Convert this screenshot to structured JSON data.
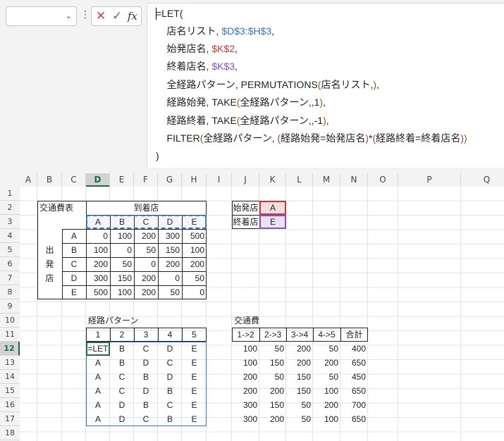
{
  "namebox": {
    "value": "",
    "caret": "⌄"
  },
  "formula_bar": {
    "dots": "⋮",
    "cancel": "✕",
    "enter": "✓",
    "fx": "fx",
    "lines": [
      [
        {
          "t": "=LET(",
          "c": ""
        }
      ],
      [
        {
          "t": "    店名リスト, ",
          "c": ""
        },
        {
          "t": "$D$3:$H$3",
          "c": "c-blue"
        },
        {
          "t": ",",
          "c": ""
        }
      ],
      [
        {
          "t": "    始発店名, ",
          "c": ""
        },
        {
          "t": "$K$2",
          "c": "c-red"
        },
        {
          "t": ",",
          "c": ""
        }
      ],
      [
        {
          "t": "    終着店名, ",
          "c": ""
        },
        {
          "t": "$K$3",
          "c": "c-purple"
        },
        {
          "t": ",",
          "c": ""
        }
      ],
      [
        {
          "t": "    全経路パターン, PERMUTATIONS",
          "c": ""
        },
        {
          "t": "(",
          "c": "c-par1"
        },
        {
          "t": "店名リスト,",
          "c": ""
        },
        {
          "t": ")",
          "c": "c-par1"
        },
        {
          "t": ",",
          "c": ""
        }
      ],
      [
        {
          "t": "    経路始発, TAKE",
          "c": ""
        },
        {
          "t": "(",
          "c": "c-par1"
        },
        {
          "t": "全経路パターン,,1",
          "c": ""
        },
        {
          "t": ")",
          "c": "c-par1"
        },
        {
          "t": ",",
          "c": ""
        }
      ],
      [
        {
          "t": "    経路終着, TAKE",
          "c": ""
        },
        {
          "t": "(",
          "c": "c-par1"
        },
        {
          "t": "全経路パターン,,-1",
          "c": ""
        },
        {
          "t": ")",
          "c": "c-par1"
        },
        {
          "t": ",",
          "c": ""
        }
      ],
      [
        {
          "t": "    FILTER",
          "c": ""
        },
        {
          "t": "(",
          "c": "c-par1"
        },
        {
          "t": "全経路パターン, ",
          "c": ""
        },
        {
          "t": "(",
          "c": "c-par2"
        },
        {
          "t": "経路始発=始発店名",
          "c": ""
        },
        {
          "t": ")",
          "c": "c-par2"
        },
        {
          "t": "*",
          "c": ""
        },
        {
          "t": "(",
          "c": "c-par2"
        },
        {
          "t": "経路終着=終着店名",
          "c": ""
        },
        {
          "t": ")",
          "c": "c-par2"
        },
        {
          "t": ")",
          "c": "c-par1"
        }
      ],
      [
        {
          "t": ")",
          "c": ""
        }
      ]
    ]
  },
  "columns": [
    "A",
    "B",
    "C",
    "D",
    "E",
    "F",
    "G",
    "H",
    "I",
    "J",
    "K",
    "L",
    "M",
    "N",
    "O",
    "P",
    "Q"
  ],
  "selected_column": "D",
  "rows": [
    "1",
    "2",
    "3",
    "4",
    "5",
    "6",
    "7",
    "8",
    "9",
    "10",
    "11",
    "12",
    "13",
    "14",
    "15",
    "16",
    "17",
    "18"
  ],
  "selected_row": "12",
  "cost_table": {
    "title": "交通費表",
    "to_header": "到着店",
    "from_header": [
      "出",
      "発",
      "店"
    ],
    "stores": [
      "A",
      "B",
      "C",
      "D",
      "E"
    ],
    "matrix": [
      [
        "0",
        "100",
        "200",
        "300",
        "500"
      ],
      [
        "100",
        "0",
        "50",
        "150",
        "100"
      ],
      [
        "200",
        "50",
        "0",
        "200",
        "200"
      ],
      [
        "300",
        "150",
        "200",
        "0",
        "50"
      ],
      [
        "500",
        "100",
        "200",
        "50",
        "0"
      ]
    ]
  },
  "params": {
    "start_label": "始発店",
    "start_value": "A",
    "end_label": "終着店",
    "end_value": "E"
  },
  "routes": {
    "title": "経路パターン",
    "headers": [
      "1",
      "2",
      "3",
      "4",
      "5"
    ],
    "rows": [
      [
        "=LET",
        "B",
        "C",
        "D",
        "E"
      ],
      [
        "A",
        "B",
        "D",
        "C",
        "E"
      ],
      [
        "A",
        "C",
        "B",
        "D",
        "E"
      ],
      [
        "A",
        "C",
        "D",
        "B",
        "E"
      ],
      [
        "A",
        "D",
        "B",
        "C",
        "E"
      ],
      [
        "A",
        "D",
        "C",
        "B",
        "E"
      ]
    ]
  },
  "costs": {
    "title": "交通費",
    "headers": [
      "1->2",
      "2->3",
      "3->4",
      "4->5",
      "合計"
    ],
    "rows": [
      [
        "100",
        "50",
        "200",
        "50",
        "400"
      ],
      [
        "100",
        "150",
        "200",
        "200",
        "650"
      ],
      [
        "200",
        "50",
        "150",
        "50",
        "450"
      ],
      [
        "200",
        "200",
        "150",
        "100",
        "650"
      ],
      [
        "300",
        "150",
        "50",
        "200",
        "700"
      ],
      [
        "300",
        "200",
        "50",
        "100",
        "650"
      ]
    ]
  }
}
